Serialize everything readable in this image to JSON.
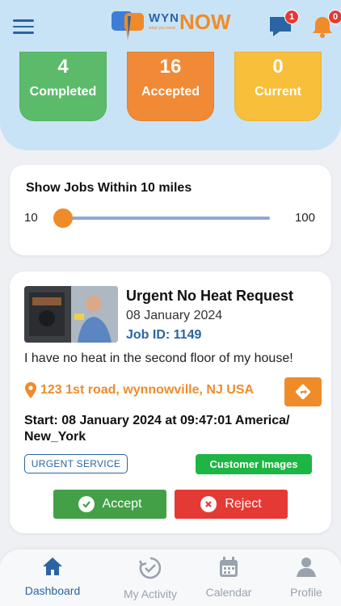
{
  "header": {
    "logo": {
      "line1": "WYN",
      "line2": "NOW",
      "tagline": "what you need"
    },
    "chat_badge": "1",
    "notif_badge": "0"
  },
  "stats": [
    {
      "value": "4",
      "label": "Completed"
    },
    {
      "value": "16",
      "label": "Accepted"
    },
    {
      "value": "0",
      "label": "Current"
    }
  ],
  "distance": {
    "title": "Show Jobs Within 10 miles",
    "min": "10",
    "max": "100",
    "level_fraction": 0.0
  },
  "job": {
    "title": "Urgent No Heat Request",
    "date": "08 January 2024",
    "job_id": "Job ID: 1149",
    "description": "I have no heat in the second floor of my house!",
    "address": "123 1st road, wynnowville, NJ USA",
    "start": "Start: 08 January 2024 at 09:47:01 America/ New_York",
    "tag": "URGENT SERVICE",
    "images_button": "Customer Images",
    "accept": "Accept",
    "reject": "Reject"
  },
  "tabs": [
    {
      "label": "Dashboard",
      "icon": "home-icon",
      "active": true
    },
    {
      "label": "My Activity",
      "icon": "activity-icon",
      "active": false
    },
    {
      "label": "Calendar",
      "icon": "calendar-icon",
      "active": false
    },
    {
      "label": "Profile",
      "icon": "profile-icon",
      "active": false
    }
  ],
  "colors": {
    "header_bg": "#c9e3f6",
    "brand_blue": "#2a64a3",
    "brand_orange": "#f08b2a",
    "completed": "#5cbb6a",
    "accepted": "#f08a36",
    "current": "#f7bf3a"
  }
}
